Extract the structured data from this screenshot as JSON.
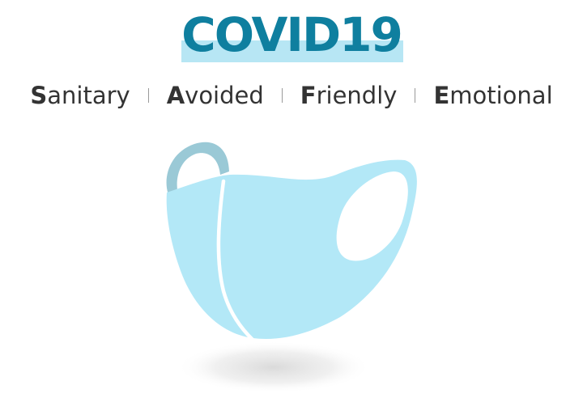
{
  "title": "COVID19",
  "acronym": [
    {
      "first": "S",
      "rest": "anitary"
    },
    {
      "first": "A",
      "rest": "voided"
    },
    {
      "first": "F",
      "rest": "riendly"
    },
    {
      "first": "E",
      "rest": "motional"
    }
  ],
  "colors": {
    "title_text": "#0f7f9f",
    "title_highlight": "#b7e6f4",
    "mask_fill": "#b3e8f7",
    "ear_loop_back": "#9ac9d6",
    "shadow": "#dcdcdc"
  },
  "illustration": {
    "icon": "face-mask-icon"
  }
}
